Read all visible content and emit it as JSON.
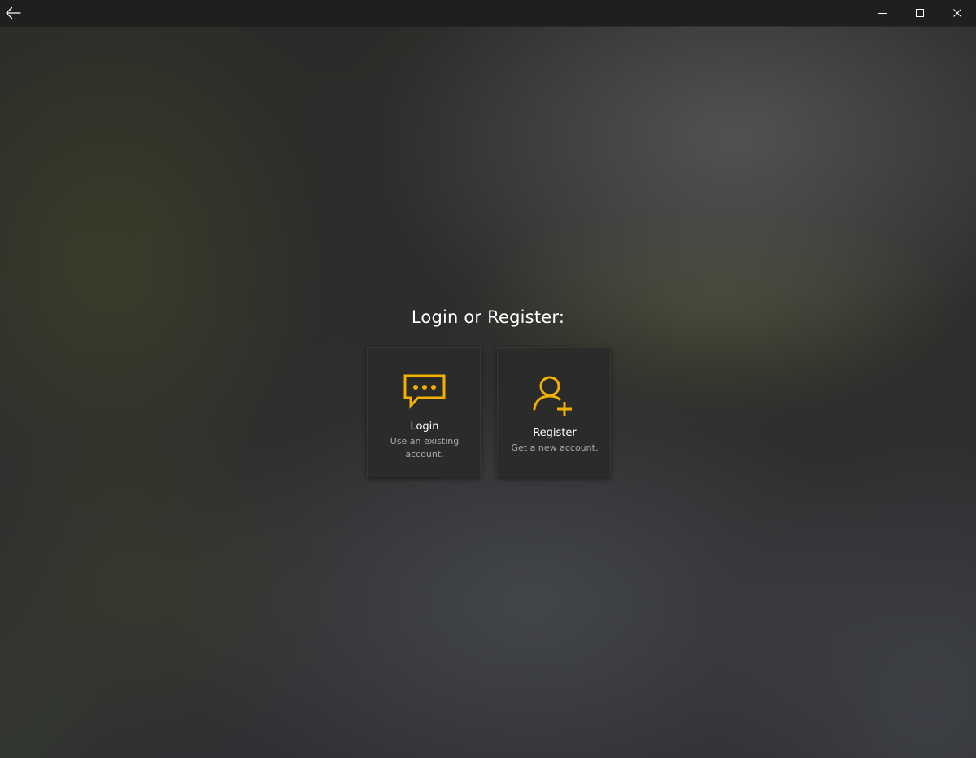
{
  "titlebar": {
    "back_icon": "arrow-left-icon",
    "controls": {
      "minimize_icon": "minimize-icon",
      "maximize_icon": "maximize-icon",
      "close_icon": "close-icon"
    }
  },
  "main": {
    "prompt": "Login or Register:",
    "cards": [
      {
        "title": "Login",
        "description": "Use an existing account.",
        "icon": "chat-bubble-icon"
      },
      {
        "title": "Register",
        "description": "Get a new account.",
        "icon": "add-user-icon"
      }
    ]
  },
  "colors": {
    "accent": "#f1b100",
    "titlebar_bg": "#1f1f1f",
    "card_bg": "#2a2a2a",
    "text_primary": "#ffffff",
    "text_secondary": "#a9a9a9"
  }
}
